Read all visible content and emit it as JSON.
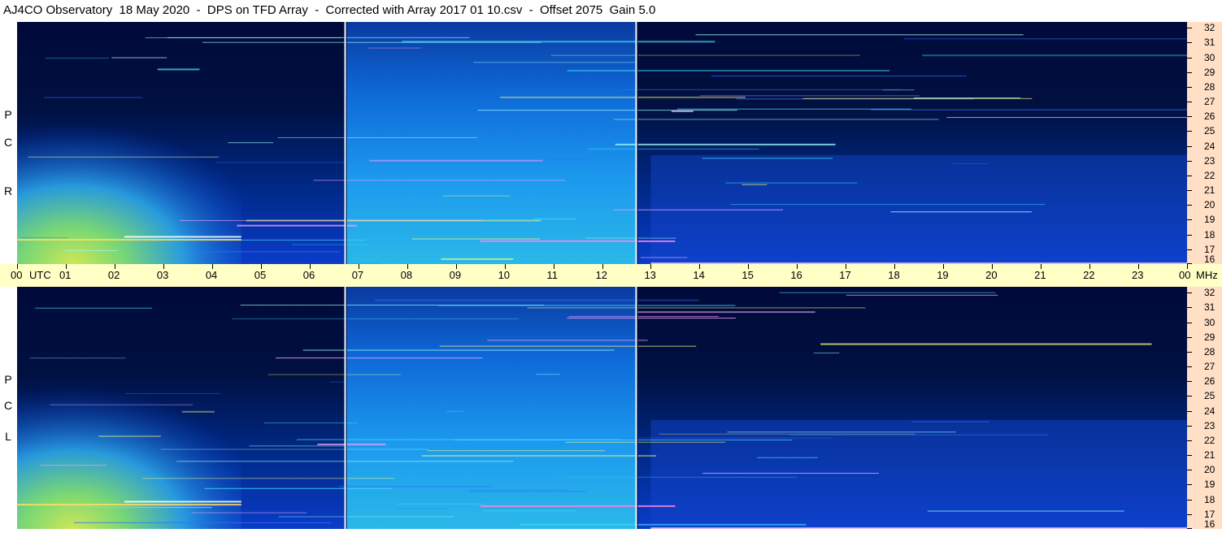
{
  "header": {
    "title": "AJ4CO Observatory  18 May 2020  -  DPS on TFD Array  -  Corrected with Array 2017 01 10.csv  -  Offset 2075  Gain 5.0"
  },
  "panels": [
    {
      "id": "top",
      "polarization": [
        "R",
        "C",
        "P"
      ]
    },
    {
      "id": "bottom",
      "polarization": [
        "L",
        "C",
        "P"
      ]
    }
  ],
  "colors": {
    "time_axis_bg": "#ffffc6",
    "freq_axis_bg": "#ffdfc6",
    "background_dark": "#000018",
    "plasma": "#1a6cf0",
    "hot": "#f0f040"
  },
  "chart_data": {
    "type": "heatmap",
    "x_axis": {
      "unit_label": "UTC",
      "ticks": [
        "00",
        "01",
        "02",
        "03",
        "04",
        "05",
        "06",
        "07",
        "08",
        "09",
        "10",
        "11",
        "12",
        "13",
        "14",
        "15",
        "16",
        "17",
        "18",
        "19",
        "20",
        "21",
        "22",
        "23",
        "00"
      ],
      "range": [
        0,
        24
      ]
    },
    "y_axis": {
      "unit_label": "MHz",
      "ticks": [
        16,
        17,
        18,
        19,
        20,
        21,
        22,
        23,
        24,
        25,
        26,
        27,
        28,
        29,
        30,
        31,
        32
      ],
      "range": [
        16,
        32.4
      ]
    },
    "vertical_markers_utc": [
      6.73,
      12.7
    ],
    "notes_visible": []
  }
}
